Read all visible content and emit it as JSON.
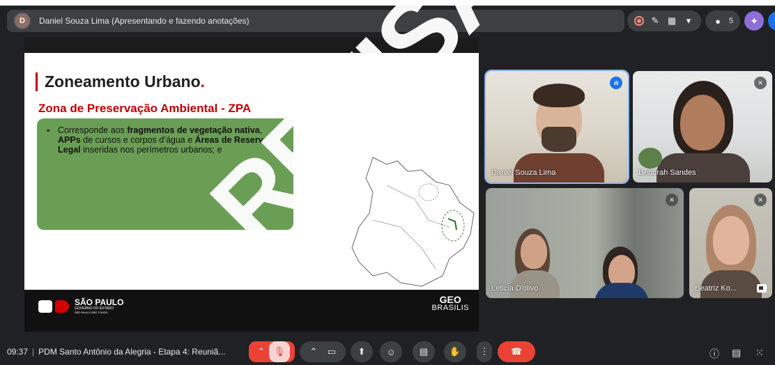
{
  "presenter": {
    "avatar_initial": "D",
    "text": "Daniel Souza Lima (Apresentando e fazendo anotações)"
  },
  "top_controls": {
    "participants_count": "5"
  },
  "slide": {
    "title": "Zoneamento Urbano",
    "title_dot": ".",
    "subtitle": "Zona de Preservação Ambiental - ZPA",
    "bullet_parts": {
      "t1": "Corresponde aos ",
      "b1": "fragmentos de vegetação nativa",
      "t2": ", ",
      "b2": "APPs",
      "t3": " de cursos e corpos d’água e ",
      "b3": "Áreas de Reserva Legal",
      "t4": " inseridas nos perímetros urbanos; e"
    },
    "footer": {
      "sp_name": "SÃO PAULO",
      "sp_sub1": "GOVERNO DO ESTADO",
      "sp_sub2": "SÃO PAULO SÃO TODOS",
      "geo_line1": "GEO",
      "geo_line2": "BRASILIS"
    }
  },
  "watermark": "REVISÃO",
  "participants": [
    {
      "name": "Daniel Souza Lima",
      "state": "speaking"
    },
    {
      "name": "Deborah Sandes",
      "state": "muted"
    },
    {
      "name": "Leticia D'olivo",
      "state": "muted"
    },
    {
      "name": "Beatriz Ko...",
      "state": "muted"
    }
  ],
  "bottom": {
    "time": "09:37",
    "separator": "|",
    "meeting_title": "PDM Santo Antônio da Alegria - Etapa 4: Reuniã..."
  },
  "colors": {
    "background": "#202124",
    "accent_red": "#ea4335",
    "slide_red": "#c00000",
    "slide_green": "#6a9e55",
    "speaking_blue": "#1a73e8"
  }
}
